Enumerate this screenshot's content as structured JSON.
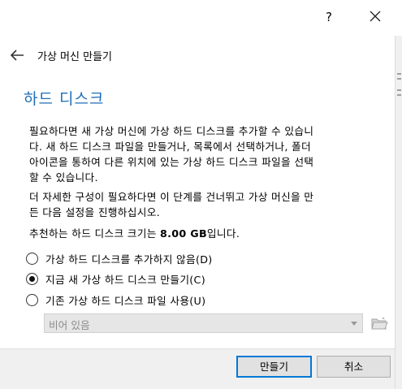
{
  "titlebar": {
    "help_label": "?",
    "close_label": "close"
  },
  "header": {
    "wizard_title": "가상 머신 만들기"
  },
  "page_title": "하드 디스크",
  "paragraphs": {
    "p1_line1": "필요하다면 새 가상 머신에 가상 하드 디스크를 추가할 수 있습니",
    "p1_line2": "다. 새 하드 디스크 파일을 만들거나, 목록에서 선택하거나, 폴더",
    "p1_line3": "아이콘을 통하여 다른 위치에 있는 가상 하드 디스크 파일을 선택",
    "p1_line4": "할 수 있습니다.",
    "p2_line1": "더 자세한 구성이 필요하다면 이 단계를 건너뛰고 가상 머신을 만",
    "p2_line2": "든 다음 설정을 진행하십시오.",
    "p3_prefix": "추천하는 하드 디스크 크기는 ",
    "p3_size": "8.00 GB",
    "p3_suffix": "입니다."
  },
  "options": {
    "no_disk": "가상 하드 디스크를 추가하지 않음(D)",
    "create_new": "지금 새 가상 하드 디스크 만들기(C)",
    "use_existing": "기존 가상 하드 디스크 파일 사용(U)",
    "selected": "create_new"
  },
  "existing_disk_combo": {
    "value": "비어 있음"
  },
  "buttons": {
    "create": "만들기",
    "cancel": "취소"
  },
  "icons": {
    "back": "back-arrow-icon",
    "close": "close-icon",
    "folder": "folder-icon",
    "dropdown": "chevron-down-icon"
  },
  "colors": {
    "title_accent": "#1e6fb8",
    "default_button_border": "#0078d7"
  }
}
